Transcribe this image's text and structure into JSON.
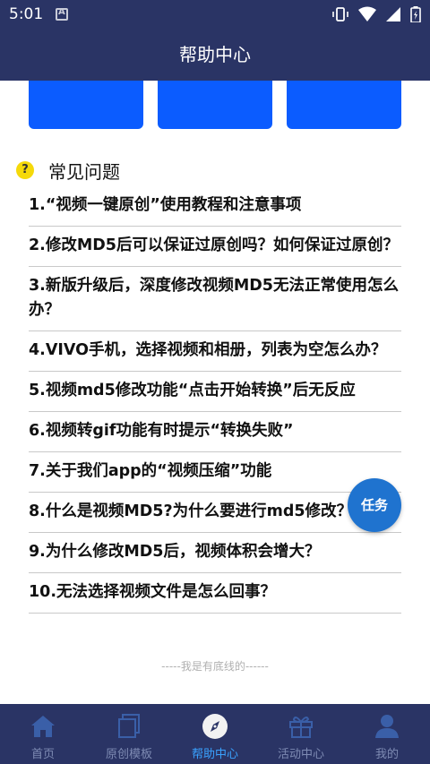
{
  "status": {
    "time": "5:01"
  },
  "header": {
    "title": "帮助中心"
  },
  "section": {
    "icon_text": "?",
    "title": "常见问题"
  },
  "faq": [
    "1.“视频一键原创”使用教程和注意事项",
    "2.修改MD5后可以保证过原创吗？如何保证过原创？",
    "3.新版升级后，深度修改视频MD5无法正常使用怎么办？",
    "4.VIVO手机，选择视频和相册，列表为空怎么办？",
    "5.视频md5修改功能“点击开始转换”后无反应",
    "6.视频转gif功能有时提示“转换失败”",
    "7.关于我们app的“视频压缩”功能",
    "8.什么是视频MD5?为什么要进行md5修改？",
    "9.为什么修改MD5后，视频体积会增大？",
    "10.无法选择视频文件是怎么回事？"
  ],
  "footer_note": "-----我是有底线的------",
  "floating": {
    "task_label": "任务"
  },
  "tabbar": {
    "home": "首页",
    "templates": "原创模板",
    "help": "帮助中心",
    "events": "活动中心",
    "mine": "我的"
  },
  "colors": {
    "bar_bg": "#2a3465",
    "tile_blue": "#0b5cff",
    "active_tab": "#3aa2ff",
    "inactive_tab": "#7e8bb3",
    "task_button": "#1f73cf"
  },
  "icons": [
    "vibrate-icon",
    "wifi-icon",
    "signal-icon",
    "battery-icon",
    "home-icon",
    "layers-icon",
    "compass-icon",
    "gift-icon",
    "user-icon"
  ]
}
